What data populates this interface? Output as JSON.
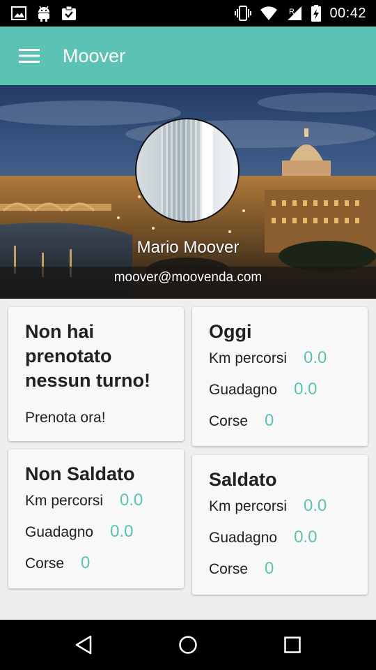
{
  "status_bar": {
    "time": "00:42",
    "left_icons": [
      "image-icon",
      "android-icon",
      "clipboard-check-icon"
    ],
    "right_icons": [
      "vibrate-icon",
      "wifi-icon",
      "signal-roaming-icon",
      "battery-charging-icon"
    ],
    "roaming_label": "R"
  },
  "app_bar": {
    "title": "Moover",
    "menu_icon": "hamburger-menu-icon",
    "color": "#5cc2b3"
  },
  "profile": {
    "name": "Mario Moover",
    "email": "moover@moovenda.com"
  },
  "cards": {
    "booking": {
      "title": "Non hai prenotato nessun turno!",
      "link": "Prenota ora!"
    },
    "today": {
      "title": "Oggi",
      "km_label": "Km percorsi",
      "km_value": "0.0",
      "earnings_label": "Guadagno",
      "earnings_value": "0.0",
      "rides_label": "Corse",
      "rides_value": "0"
    },
    "unpaid": {
      "title": "Non Saldato",
      "km_label": "Km percorsi",
      "km_value": "0.0",
      "earnings_label": "Guadagno",
      "earnings_value": "0.0",
      "rides_label": "Corse",
      "rides_value": "0"
    },
    "paid": {
      "title": "Saldato",
      "km_label": "Km percorsi",
      "km_value": "0.0",
      "earnings_label": "Guadagno",
      "earnings_value": "0.0",
      "rides_label": "Corse",
      "rides_value": "0"
    }
  },
  "nav_bar": {
    "icons": [
      "back-icon",
      "home-icon",
      "recents-icon"
    ]
  },
  "colors": {
    "accent": "#5cc2b3",
    "background": "#eeeeee",
    "card": "#f8f8f8"
  }
}
